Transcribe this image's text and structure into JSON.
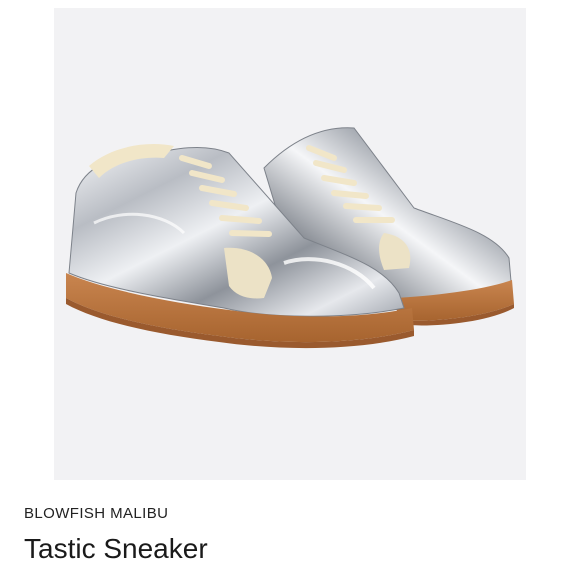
{
  "product": {
    "brand": "BLOWFISH MALIBU",
    "name": "Tastic Sneaker",
    "image": {
      "subject": "pair of sneakers",
      "colors": {
        "panel_background": "#f2f2f4",
        "upper_metallic": "#c9ccd1",
        "metallic_highlight": "#f7f8fa",
        "metallic_shadow": "#8e939b",
        "laces": "#f1e6c8",
        "gum_sole": "#c07a45",
        "sole_dark": "#9a5a2e",
        "suede_panel": "#ece2c6"
      }
    }
  }
}
